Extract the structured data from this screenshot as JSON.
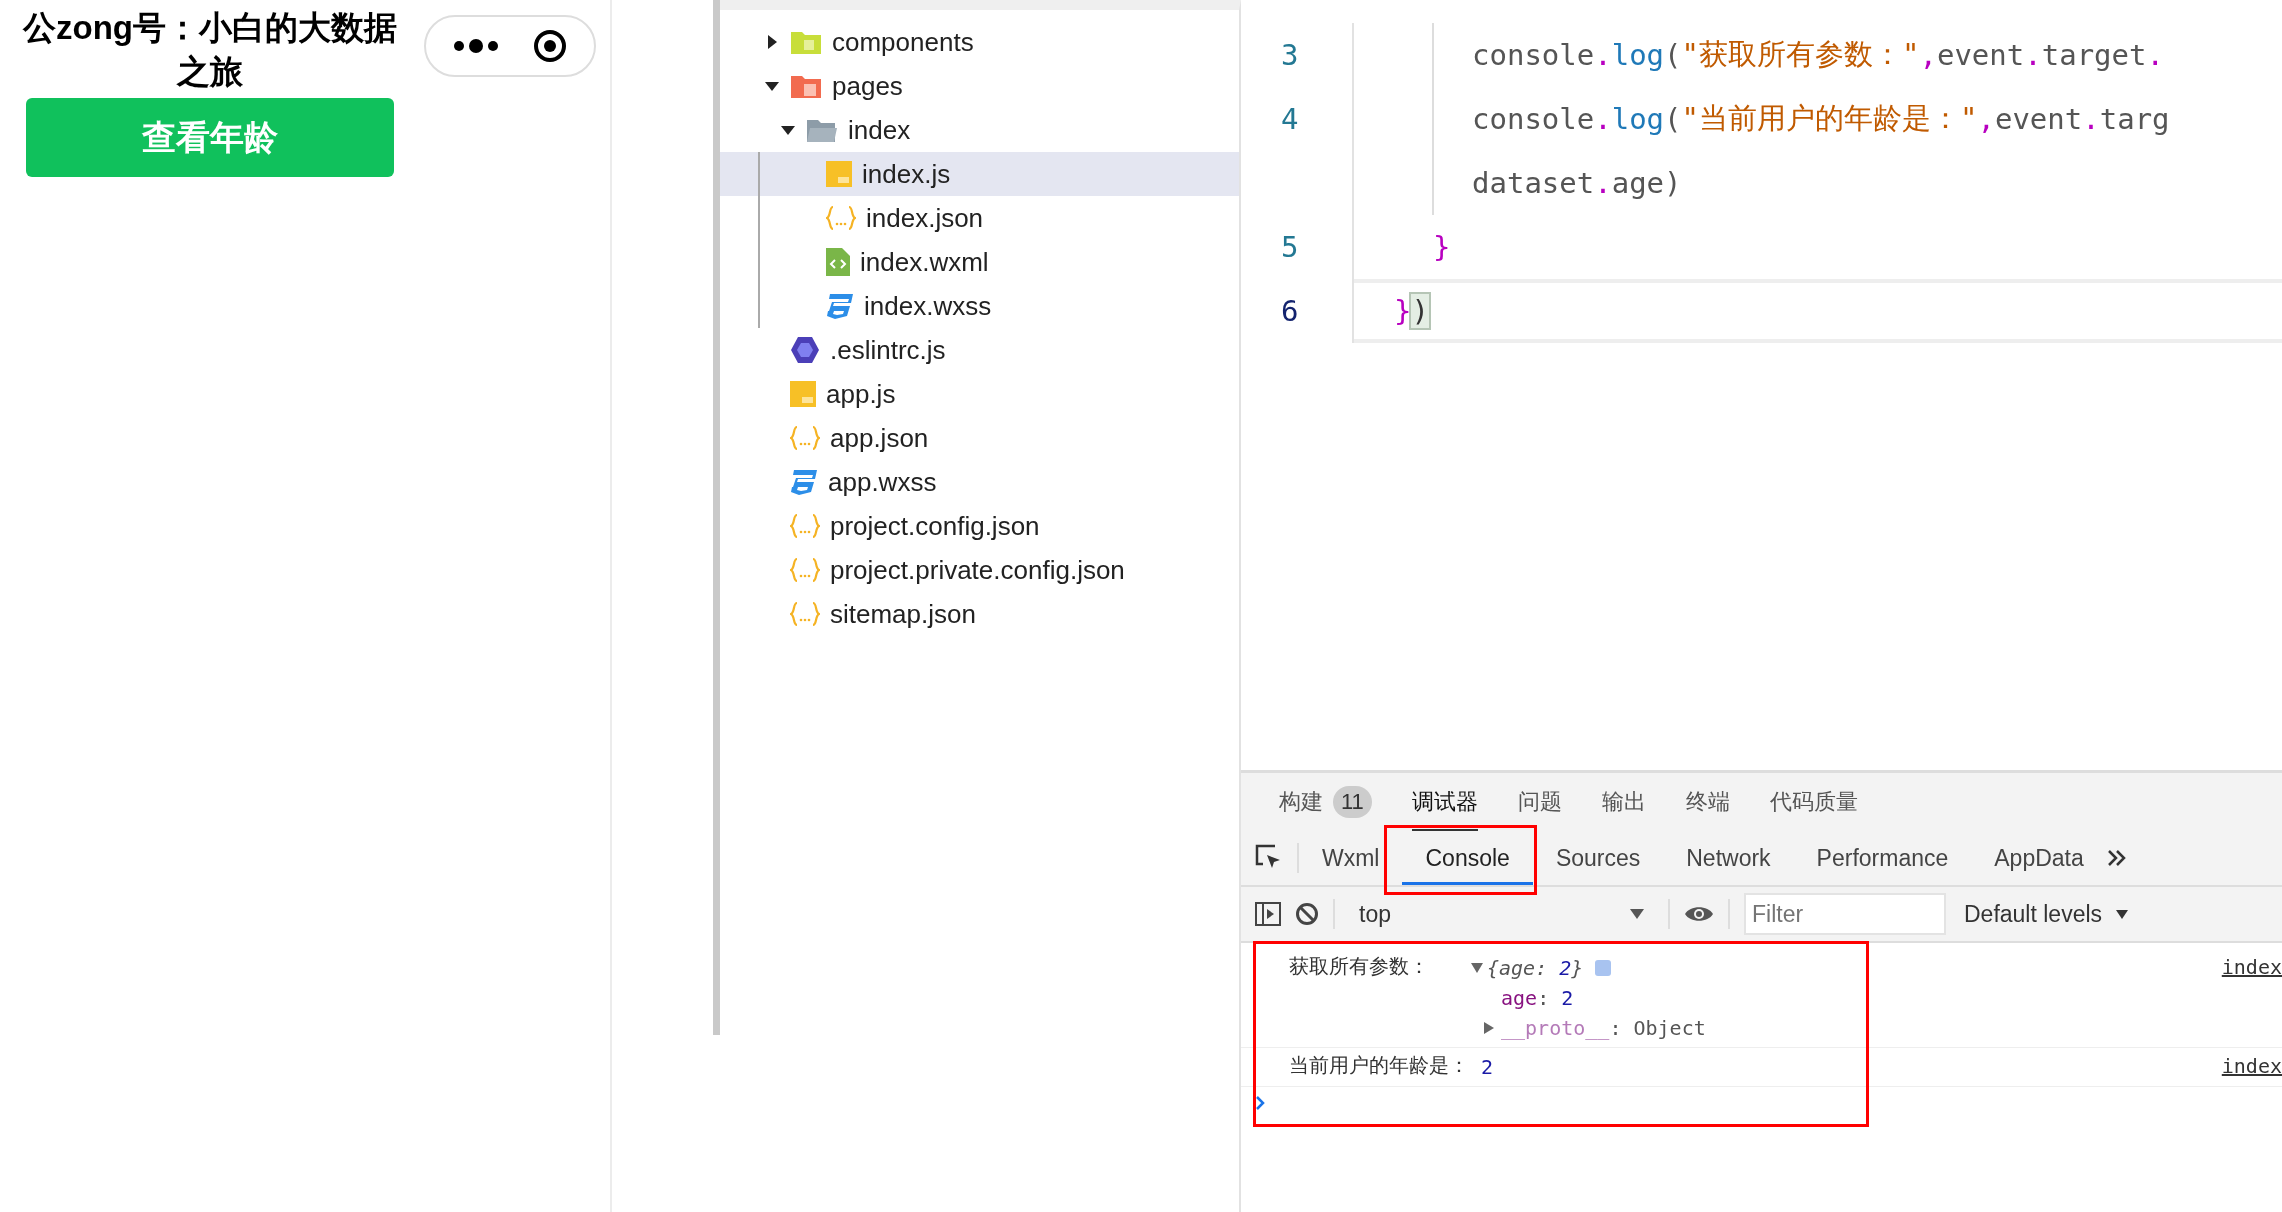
{
  "phone": {
    "title": "公zong号：小白的大数据之旅",
    "button": "查看年龄"
  },
  "file_tree": [
    {
      "name": "components",
      "kind": "folder_components",
      "expanded": false,
      "selected": false
    },
    {
      "name": "pages",
      "kind": "folder_pages",
      "expanded": true,
      "selected": false,
      "children": [
        {
          "name": "index",
          "kind": "folder",
          "expanded": true,
          "selected": false,
          "children": [
            {
              "name": "index.js",
              "kind": "js",
              "selected": true
            },
            {
              "name": "index.json",
              "kind": "json",
              "selected": false
            },
            {
              "name": "index.wxml",
              "kind": "wxml",
              "selected": false
            },
            {
              "name": "index.wxss",
              "kind": "wxss",
              "selected": false
            }
          ]
        }
      ]
    },
    {
      "name": ".eslintrc.js",
      "kind": "eslint",
      "selected": false
    },
    {
      "name": "app.js",
      "kind": "js",
      "selected": false
    },
    {
      "name": "app.json",
      "kind": "json",
      "selected": false
    },
    {
      "name": "app.wxss",
      "kind": "wxss",
      "selected": false
    },
    {
      "name": "project.config.json",
      "kind": "json",
      "selected": false
    },
    {
      "name": "project.private.config.json",
      "kind": "json",
      "selected": false
    },
    {
      "name": "sitemap.json",
      "kind": "json",
      "selected": false
    }
  ],
  "editor": {
    "lines": [
      {
        "number": "3",
        "kind": "body",
        "current": false,
        "tokens": [
          {
            "text": "console",
            "kind": "plain"
          },
          {
            "text": ".",
            "kind": "punct"
          },
          {
            "text": "log",
            "kind": "method"
          },
          {
            "text": "(",
            "kind": "plain"
          },
          {
            "text": "\"获取所有参数：\"",
            "kind": "string"
          },
          {
            "text": ",",
            "kind": "punct"
          },
          {
            "text": "event",
            "kind": "plain"
          },
          {
            "text": ".",
            "kind": "punct"
          },
          {
            "text": "target",
            "kind": "plain"
          },
          {
            "text": ".",
            "kind": "punct"
          }
        ]
      },
      {
        "number": "4",
        "kind": "body",
        "current": false,
        "tokens": [
          {
            "text": "console",
            "kind": "plain"
          },
          {
            "text": ".",
            "kind": "punct"
          },
          {
            "text": "log",
            "kind": "method"
          },
          {
            "text": "(",
            "kind": "plain"
          },
          {
            "text": "\"当前用户的年龄是：\"",
            "kind": "string"
          },
          {
            "text": ",",
            "kind": "punct"
          },
          {
            "text": "event",
            "kind": "plain"
          },
          {
            "text": ".",
            "kind": "punct"
          },
          {
            "text": "targ",
            "kind": "plain"
          }
        ]
      },
      {
        "kind": "body",
        "current": false,
        "tokens": [
          {
            "text": "dataset",
            "kind": "plain"
          },
          {
            "text": ".",
            "kind": "punct"
          },
          {
            "text": "age",
            "kind": "plain"
          },
          {
            "text": ")",
            "kind": "plain"
          }
        ]
      },
      {
        "number": "5",
        "kind": "block_close",
        "current": false,
        "tokens": [
          {
            "text": "}",
            "kind": "punct"
          }
        ]
      },
      {
        "number": "6",
        "kind": "call_close",
        "current": true,
        "tokens": [
          {
            "text": "}",
            "kind": "punct"
          },
          {
            "text": ")",
            "kind": "bracket_match"
          }
        ]
      }
    ]
  },
  "devtools": {
    "panel_tabs": [
      {
        "label": "构建",
        "badge": "11",
        "selected": false
      },
      {
        "label": "调试器",
        "selected": true
      },
      {
        "label": "问题",
        "selected": false
      },
      {
        "label": "输出",
        "selected": false
      },
      {
        "label": "终端",
        "selected": false
      },
      {
        "label": "代码质量",
        "selected": false
      }
    ],
    "tabs": [
      {
        "label": "Wxml",
        "selected": false,
        "highlighted": false
      },
      {
        "label": "Console",
        "selected": true,
        "highlighted": true
      },
      {
        "label": "Sources",
        "selected": false,
        "highlighted": false
      },
      {
        "label": "Network",
        "selected": false,
        "highlighted": false
      },
      {
        "label": "Performance",
        "selected": false,
        "highlighted": false
      },
      {
        "label": "AppData",
        "selected": false,
        "highlighted": false
      }
    ],
    "context": "top",
    "filter_placeholder": "Filter",
    "levels": "Default levels",
    "output_highlighted": true,
    "messages": [
      {
        "kind": "object",
        "label": "获取所有参数：",
        "expanded": true,
        "preview": [
          {
            "text": "{age: ",
            "kind": "plain"
          },
          {
            "text": "2",
            "kind": "number"
          },
          {
            "text": "}",
            "kind": "plain"
          }
        ],
        "properties": [
          {
            "expandable": false,
            "tokens": [
              {
                "text": "age",
                "kind": "key"
              },
              {
                "text": ": ",
                "kind": "plain"
              },
              {
                "text": "2",
                "kind": "number"
              }
            ]
          },
          {
            "expandable": true,
            "tokens": [
              {
                "text": "__proto__",
                "kind": "proto"
              },
              {
                "text": ": ",
                "kind": "plain"
              },
              {
                "text": "Object",
                "kind": "plain"
              }
            ]
          }
        ],
        "source": "index"
      },
      {
        "kind": "value",
        "label": "当前用户的年龄是：",
        "value": "2",
        "source": "index"
      }
    ]
  }
}
